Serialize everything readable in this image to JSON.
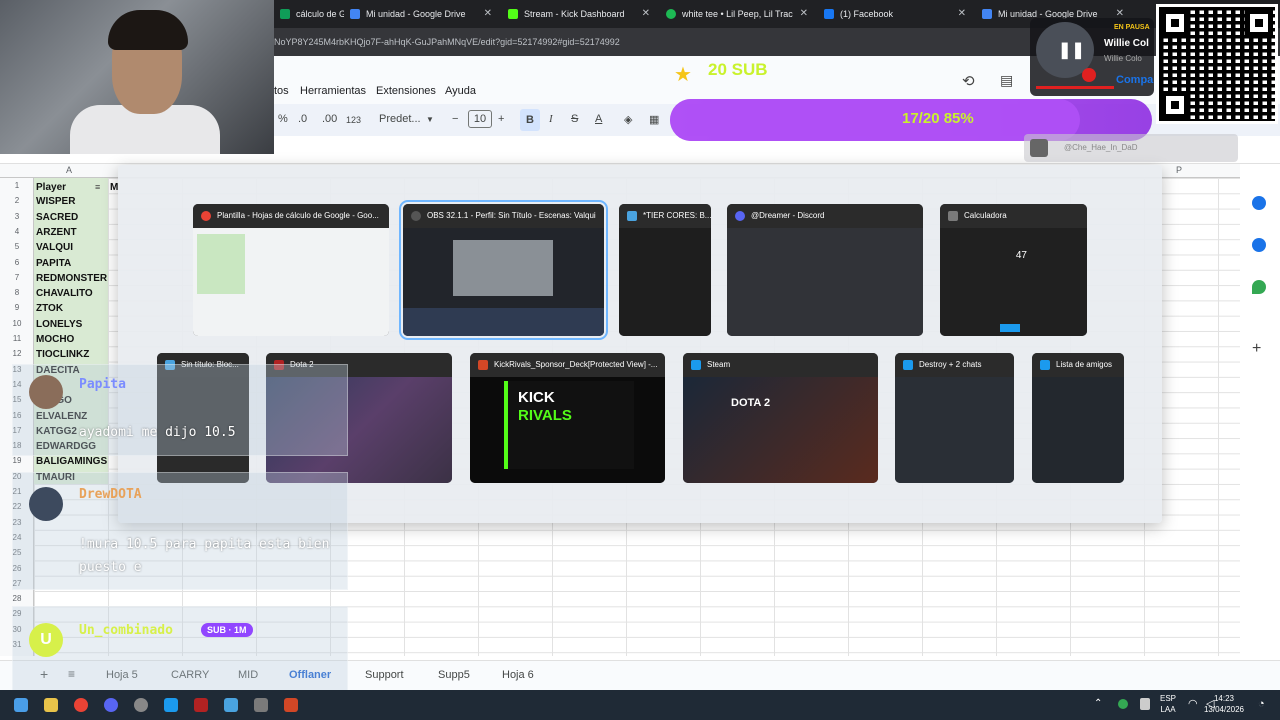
{
  "browser": {
    "tabs": [
      {
        "label": "cálculo de G",
        "color": "#0f9d58"
      },
      {
        "label": "Mi unidad - Google Drive",
        "color": "#4285f4"
      },
      {
        "label": "Stream - Kick Dashboard",
        "color": "#53fc18"
      },
      {
        "label": "white tee • Lil Peep, Lil Trac",
        "color": "#1db954"
      },
      {
        "label": "(1) Facebook",
        "color": "#1877f2"
      },
      {
        "label": "Mi unidad - Google Drive",
        "color": "#4285f4"
      }
    ],
    "url": "NoYP8Y245M4rbKHQjo7F-ahHqK-GuJPahMNqVE/edit?gid=52174992#gid=52174992"
  },
  "sheets": {
    "menus": [
      "tos",
      "Herramientas",
      "Extensiones",
      "Ayuda"
    ],
    "toolbar": {
      "percent": "%",
      "dec_minus": ".0",
      "dec_plus": ".00",
      "format_123": "123",
      "font": "Predet...",
      "minus": "−",
      "font_size": "10",
      "plus": "+",
      "bold": "B",
      "italic": "I",
      "strike": "S",
      "underline_a": "A"
    },
    "col_a": "A",
    "col_p": "P",
    "header": "Player",
    "header_m": "M",
    "players": [
      "WISPER",
      "SACRED",
      "ARZENT",
      "VALQUI",
      "PAPITA",
      "REDMONSTER",
      "CHAVALITO",
      "ZTOK",
      "LONELYS",
      "MOCHO",
      "TIOCLINKZ",
      "DAECITA",
      "",
      "PANGO",
      "ELVALENZ",
      "KATGG2",
      "EDWARDGG",
      "BALIGAMINGS",
      "TMAURI"
    ],
    "row_numbers": [
      "1",
      "2",
      "3",
      "4",
      "5",
      "6",
      "7",
      "8",
      "9",
      "10",
      "11",
      "12",
      "13",
      "14",
      "15",
      "16",
      "17",
      "18",
      "19",
      "20",
      "21",
      "22",
      "23",
      "24",
      "25",
      "26",
      "27",
      "28",
      "29",
      "30",
      "31"
    ],
    "sheet_tabs": [
      "Hoja 5",
      "CARRY",
      "MID",
      "Offlaner",
      "Support",
      "Supp5",
      "Hoja 6"
    ],
    "active_sheet": "Offlaner"
  },
  "switcher": {
    "row1": [
      {
        "title": "Plantilla - Hojas de cálculo de Google - Goo...",
        "icon_color": "#ea4335",
        "thumb": "#f1f3f4"
      },
      {
        "title": "OBS 32.1.1 - Perfil: Sin Título - Escenas: Valqui",
        "icon_color": "#333333",
        "thumb": "#22252b"
      },
      {
        "title": "*TIER CORES: B...",
        "icon_color": "#4aa3df",
        "thumb": "#1e1e1e"
      },
      {
        "title": "@Dreamer - Discord",
        "icon_color": "#5865f2",
        "thumb": "#313338"
      },
      {
        "title": "Calculadora",
        "icon_color": "#7a7a7a",
        "thumb": "#202020",
        "display": "47"
      }
    ],
    "row2": [
      {
        "title": "Sin título: Bloc...",
        "icon_color": "#4aa3df",
        "thumb": "#2a2a2a"
      },
      {
        "title": "Dota 2",
        "icon_color": "#b22222",
        "thumb": "#3b3145"
      },
      {
        "title": "KickRivals_Sponsor_Deck[Protected View] -...",
        "icon_color": "#d24726",
        "thumb": "#0b0b0b",
        "kick_title": "KICK",
        "kick_sub": "RIVALS"
      },
      {
        "title": "Steam",
        "icon_color": "#1b9aee",
        "thumb": "#1b2838",
        "game_text": "DOTA 2"
      },
      {
        "title": "Destroy + 2 chats",
        "icon_color": "#1b9aee",
        "thumb": "#2a2f36"
      },
      {
        "title": "Lista de amigos",
        "icon_color": "#1b9aee",
        "thumb": "#23282e"
      }
    ]
  },
  "overlay": {
    "sub_label": "20 SUB",
    "goal_text": "17/20 85%",
    "goal_progress": 0.85,
    "player_status": "EN PAUSA",
    "player_name": "Willie Col",
    "player_sub": "Willie Colo",
    "share_label": "Compa",
    "comment_user": "@Che_Hae_In_DaD"
  },
  "chat": [
    {
      "user": "Papita",
      "user_color": "#7b8cff",
      "text": "ayadomi me dijo 10.5"
    },
    {
      "user": "DrewDOTA",
      "user_color": "#e8a25a",
      "text": "!mura 10.5 para papita esta bien puesto e"
    },
    {
      "user": "Un_combinado",
      "user_color": "#d7f04a",
      "badge": "SUB · 1M",
      "avatar_letter": "U"
    }
  ],
  "taskbar": {
    "lang_top": "ESP",
    "lang_bottom": "LAA",
    "time": "14:23",
    "date": "13/04/2026"
  }
}
